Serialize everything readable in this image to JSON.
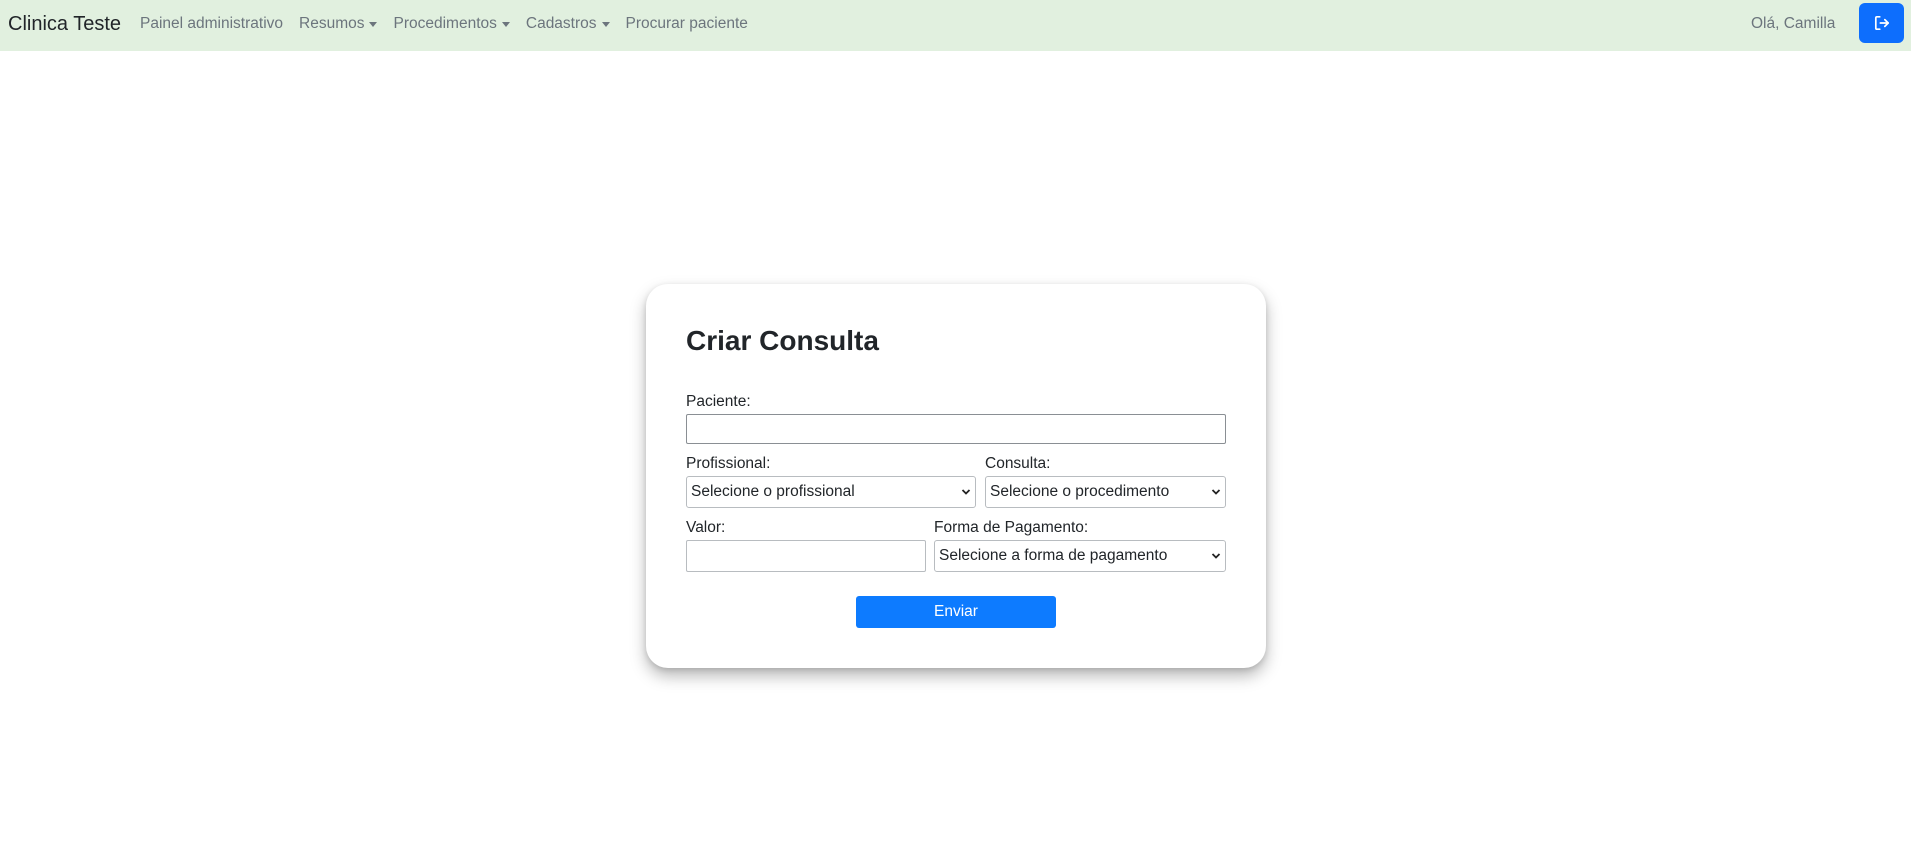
{
  "nav": {
    "brand": "Clinica Teste",
    "items": [
      {
        "label": "Painel administrativo",
        "dropdown": false
      },
      {
        "label": "Resumos",
        "dropdown": true
      },
      {
        "label": "Procedimentos",
        "dropdown": true
      },
      {
        "label": "Cadastros",
        "dropdown": true
      },
      {
        "label": "Procurar paciente",
        "dropdown": false
      }
    ],
    "greeting": "Olá, Camilla",
    "logout_icon": "logout-icon"
  },
  "form": {
    "title": "Criar Consulta",
    "paciente_label": "Paciente:",
    "paciente_value": "",
    "profissional_label": "Profissional:",
    "profissional_selected": "Selecione o profissional",
    "consulta_label": "Consulta:",
    "consulta_selected": "Selecione o procedimento",
    "valor_label": "Valor:",
    "valor_value": "",
    "pagamento_label": "Forma de Pagamento:",
    "pagamento_selected": "Selecione a forma de pagamento",
    "submit_label": "Enviar"
  },
  "colors": {
    "navbar_bg": "#e1f0df",
    "primary": "#0d6efd",
    "submit": "#0d7bff"
  }
}
